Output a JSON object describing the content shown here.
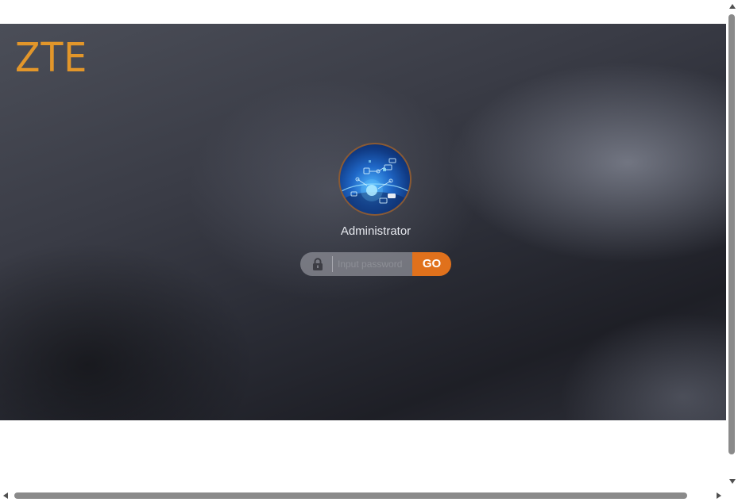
{
  "brand": {
    "logo_text": "ZTE",
    "accent_color": "#e2962a"
  },
  "login": {
    "username": "Administrator",
    "avatar_icon": "network-globe-avatar",
    "lock_icon": "lock-icon",
    "password_placeholder": "Input password",
    "password_value": "",
    "submit_label": "GO",
    "submit_color": "#e0711c"
  },
  "scrollbars": {
    "vertical_icon_up": "arrow-up-icon",
    "vertical_icon_down": "arrow-down-icon",
    "horizontal_icon_left": "arrow-left-icon",
    "horizontal_icon_right": "arrow-right-icon"
  }
}
